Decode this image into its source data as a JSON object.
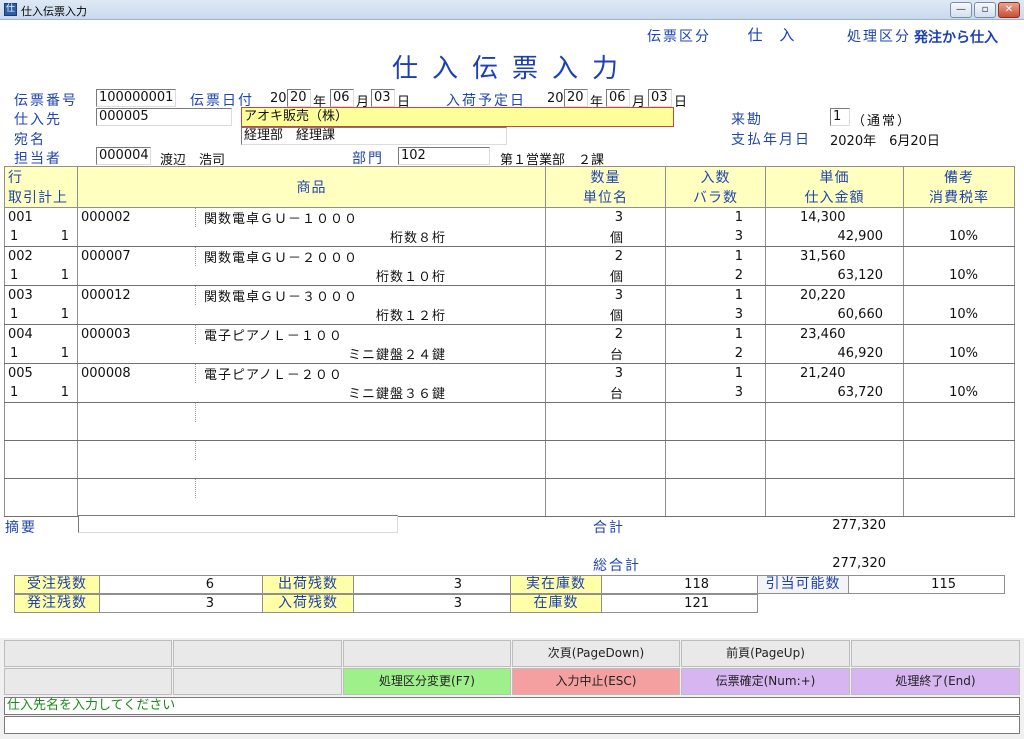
{
  "window": {
    "title": "仕入伝票入力",
    "icon": "app-icon",
    "btn_min": "—",
    "btn_max": "▫",
    "btn_close": "✕"
  },
  "header": {
    "denpyo_kubun_label": "伝票区分",
    "denpyo_kubun_value": "仕 入",
    "shori_kubun_label": "処理区分",
    "shori_kubun_value": "発注から仕入",
    "form_title": "仕入伝票入力"
  },
  "fields": {
    "denpyo_no_label": "伝票番号",
    "denpyo_no": "100000001",
    "denpyo_date_label": "伝票日付",
    "date_prefix": "20",
    "denpyo_year": "20",
    "year_unit": "年",
    "denpyo_month": "06",
    "month_unit": "月",
    "denpyo_day": "03",
    "day_unit": "日",
    "nyuka_date_label": "入荷予定日",
    "nyuka_year": "20",
    "nyuka_month": "06",
    "nyuka_day": "03",
    "shiiresaki_label": "仕入先",
    "shiiresaki_code": "000005",
    "shiiresaki_name": "アオキ販売（株）",
    "atena_label": "宛名",
    "atena_value": "経理部　経理課",
    "tantosha_label": "担当者",
    "tantosha_code": "000004",
    "tantosha_name": "渡辺　浩司",
    "bumon_label": "部門",
    "bumon_code": "102",
    "bumon_name": "第１営業部　２課",
    "raikin_label": "来勘",
    "raikin_value": "1",
    "raikin_note": "（通常）",
    "shiharai_label": "支払年月日",
    "shiharai_value": "2020年　6月20日"
  },
  "grid": {
    "headers": {
      "gyo": "行",
      "torihiki": "取引計上",
      "shohin": "商品",
      "suryo": "数量",
      "tanimei": "単位名",
      "irisu": "入数",
      "barasu": "バラ数",
      "tanka": "単価",
      "shiire_kingaku": "仕入金額",
      "biko": "備考",
      "shohizei": "消費税率"
    },
    "rows": [
      {
        "line": "001",
        "code": "000002",
        "name": "関数電卓ＧＵ－１０００",
        "qty": "3",
        "irisu": "1",
        "price": "14,300",
        "t1": "1",
        "t2": "1",
        "spec": "桁数８桁",
        "unit": "個",
        "bara": "3",
        "amount": "42,900",
        "tax": "10%"
      },
      {
        "line": "002",
        "code": "000007",
        "name": "関数電卓ＧＵ－２０００",
        "qty": "2",
        "irisu": "1",
        "price": "31,560",
        "t1": "1",
        "t2": "1",
        "spec": "桁数１０桁",
        "unit": "個",
        "bara": "2",
        "amount": "63,120",
        "tax": "10%"
      },
      {
        "line": "003",
        "code": "000012",
        "name": "関数電卓ＧＵ－３０００",
        "qty": "3",
        "irisu": "1",
        "price": "20,220",
        "t1": "1",
        "t2": "1",
        "spec": "桁数１２桁",
        "unit": "個",
        "bara": "3",
        "amount": "60,660",
        "tax": "10%"
      },
      {
        "line": "004",
        "code": "000003",
        "name": "電子ピアノＬ－１００",
        "qty": "2",
        "irisu": "1",
        "price": "23,460",
        "t1": "1",
        "t2": "1",
        "spec": "ミニ鍵盤２４鍵",
        "unit": "台",
        "bara": "2",
        "amount": "46,920",
        "tax": "10%"
      },
      {
        "line": "005",
        "code": "000008",
        "name": "電子ピアノＬ－２００",
        "qty": "3",
        "irisu": "1",
        "price": "21,240",
        "t1": "1",
        "t2": "1",
        "spec": "ミニ鍵盤３６鍵",
        "unit": "台",
        "bara": "3",
        "amount": "63,720",
        "tax": "10%"
      }
    ]
  },
  "totals": {
    "tekiyo_label": "摘要",
    "tekiyo_value": "",
    "gokei_label": "合計",
    "gokei_value": "277,320",
    "sogokei_label": "総合計",
    "sogokei_value": "277,320"
  },
  "stock": {
    "juchu_label": "受注残数",
    "juchu_value": "6",
    "shukka_label": "出荷残数",
    "shukka_value": "3",
    "jitsuzaiko_label": "実在庫数",
    "jitsuzaiko_value": "118",
    "hikiate_label": "引当可能数",
    "hikiate_value": "115",
    "hatchu_label": "発注残数",
    "hatchu_value": "3",
    "nyuka_label": "入荷残数",
    "nyuka_value": "3",
    "zaiko_label": "在庫数",
    "zaiko_value": "121"
  },
  "function_keys": {
    "next_page": "次頁(PageDown)",
    "prev_page": "前頁(PageUp)",
    "change_kubun": "処理区分変更(F7)",
    "cancel_input": "入力中止(ESC)",
    "confirm": "伝票確定(Num:+)",
    "end": "処理終了(End)"
  },
  "colors": {
    "label_blue": "#2046b0",
    "header_yellow": "#ffffc0",
    "green_key": "#9ef08a",
    "red_key": "#f5a0a0",
    "purple_key": "#d7b5f0",
    "status_green": "#1a8a1a"
  },
  "status": {
    "message": "仕入先名を入力してください"
  }
}
